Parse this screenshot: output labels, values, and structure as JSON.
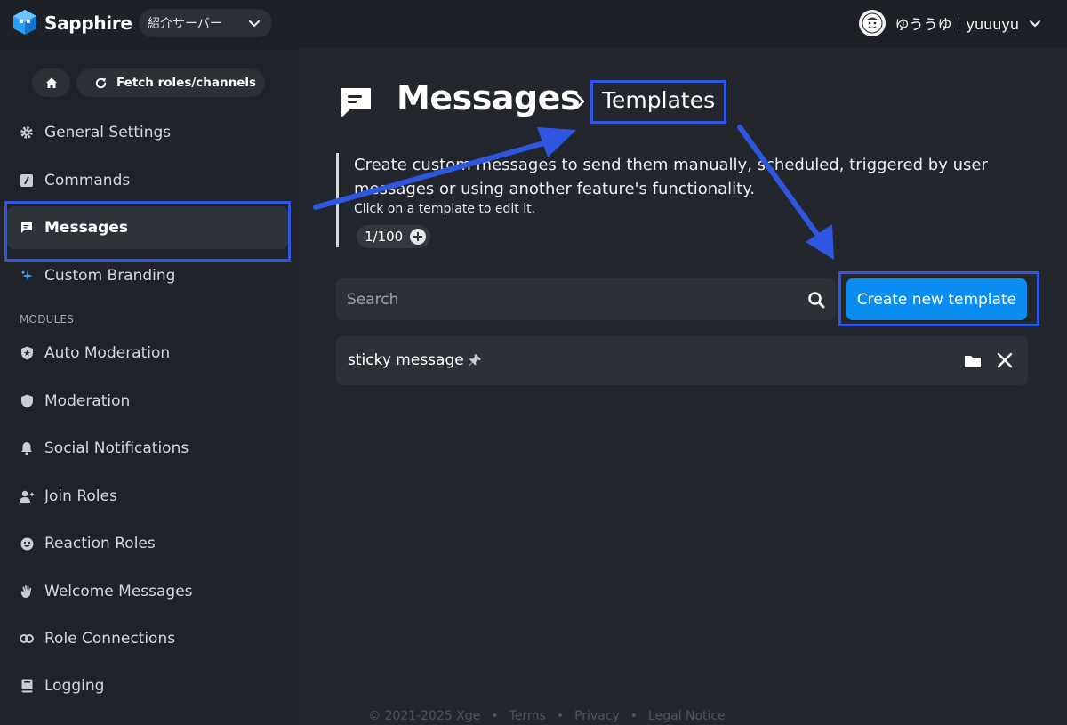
{
  "topbar": {
    "brand": "Sapphire",
    "server_name": "紹介サーバー",
    "user_name": "ゆううゆ｜yuuuyu"
  },
  "sidebar": {
    "fetch_label": "Fetch roles/channels",
    "items": [
      {
        "label": "General Settings",
        "icon": "gear-icon"
      },
      {
        "label": "Commands",
        "icon": "slash-command-icon"
      },
      {
        "label": "Messages",
        "icon": "message-icon",
        "active": true
      },
      {
        "label": "Custom Branding",
        "icon": "sparkle-icon"
      }
    ],
    "section_label": "MODULES",
    "modules": [
      {
        "label": "Auto Moderation",
        "icon": "shield-star-icon"
      },
      {
        "label": "Moderation",
        "icon": "shield-icon"
      },
      {
        "label": "Social Notifications",
        "icon": "bell-icon"
      },
      {
        "label": "Join Roles",
        "icon": "user-plus-icon"
      },
      {
        "label": "Reaction Roles",
        "icon": "smiley-icon"
      },
      {
        "label": "Welcome Messages",
        "icon": "wave-hand-icon"
      },
      {
        "label": "Role Connections",
        "icon": "link-icon"
      },
      {
        "label": "Logging",
        "icon": "book-icon"
      }
    ]
  },
  "main": {
    "title": "Messages",
    "breadcrumb_current": "Templates",
    "description": "Create custom messages to send them manually, scheduled, triggered by user messages or using another feature's functionality.",
    "hint": "Click on a template to edit it.",
    "counter": "1/100",
    "search_placeholder": "Search",
    "create_button": "Create new template",
    "templates": [
      {
        "name": "sticky message",
        "pinned": true
      }
    ]
  },
  "footer": {
    "copyright": "© 2021-2025 Xge",
    "links": [
      "Terms",
      "Privacy",
      "Legal Notice"
    ]
  },
  "colors": {
    "accent": "#0a8cf0",
    "annotation": "#2f56e0",
    "background": "#23262d",
    "sidebar": "#1f2228"
  }
}
